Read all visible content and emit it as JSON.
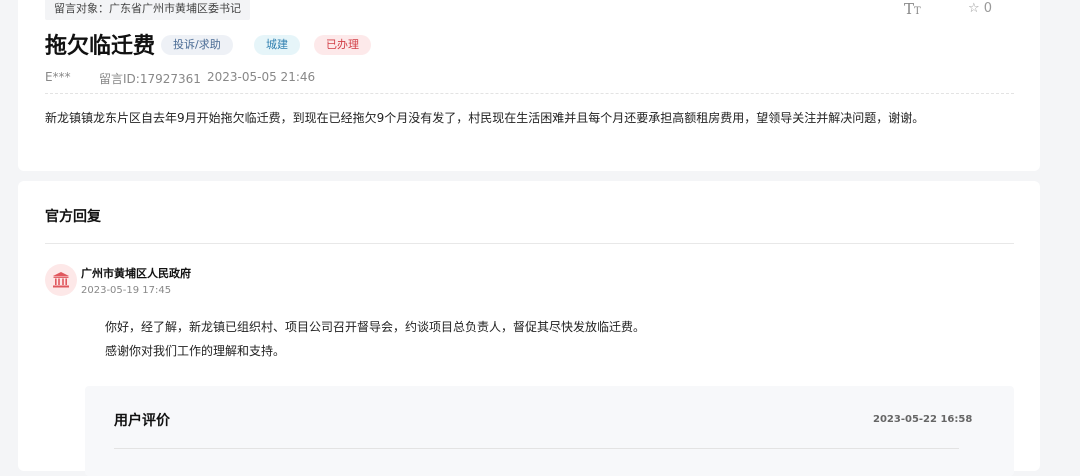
{
  "header": {
    "target_label": "留言对象：广东省广州市黄埔区委书记",
    "font_size_icon": "font-size-icon",
    "star_icon": "star-outline-icon",
    "star_count": "0"
  },
  "message": {
    "title": "拖欠临迁费",
    "tags": {
      "category": "投诉/求助",
      "field": "城建",
      "status": "已办理"
    },
    "tag_colors": {
      "category_bg": "#eef1f6",
      "field_bg": "#e6f5f9",
      "status_bg": "#fde9ea",
      "status_text": "#d23f47"
    },
    "user": "E***",
    "message_id": "留言ID:17927361",
    "time": "2023-05-05 21:46",
    "content": "新龙镇镇龙东片区自去年9月开始拖欠临迁费，到现在已经拖欠9个月没有发了，村民现在生活困难并且每个月还要承担高额租房费用，望领导关注并解决问题，谢谢。"
  },
  "reply": {
    "section_title": "官方回复",
    "department": "广州市黄埔区人民政府",
    "department_icon": "government-building-icon",
    "time": "2023-05-19 17:45",
    "lines": [
      "你好，经了解，新龙镇已组织村、项目公司召开督导会，约谈项目总负责人，督促其尽快发放临迁费。",
      "感谢你对我们工作的理解和支持。"
    ]
  },
  "evaluation": {
    "title": "用户评价",
    "time": "2023-05-22 16:58"
  }
}
